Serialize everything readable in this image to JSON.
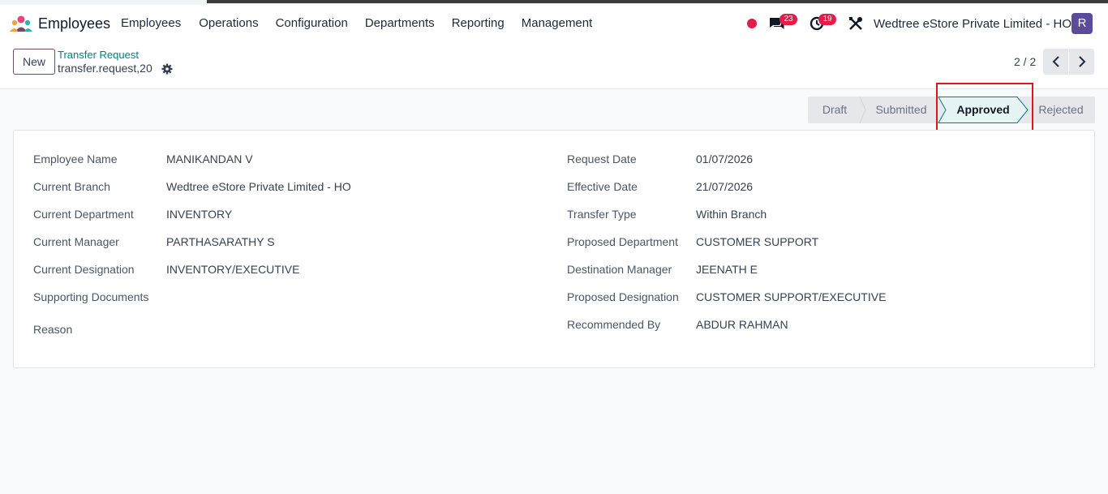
{
  "navbar": {
    "app_name": "Employees",
    "menu": [
      "Employees",
      "Operations",
      "Configuration",
      "Departments",
      "Reporting",
      "Management"
    ],
    "messages_count": "23",
    "activities_count": "19",
    "company": "Wedtree eStore Private Limited - HO",
    "avatar_initial": "R",
    "colors": {
      "badge": "#e11d48",
      "avatar": "#5b4b9a"
    },
    "icons": [
      "app-logo-icon",
      "status-dot-icon",
      "chat-icon",
      "clock-icon",
      "tools-icon"
    ]
  },
  "control": {
    "new_label": "New",
    "breadcrumb_parent": "Transfer Request",
    "breadcrumb_current": "transfer.request,20",
    "pager": "2 / 2",
    "icons": [
      "gear-icon",
      "chevron-left-icon",
      "chevron-right-icon"
    ]
  },
  "statusbar": {
    "stages": [
      "Draft",
      "Submitted",
      "Approved",
      "Rejected"
    ],
    "active": "Approved",
    "colors": {
      "active_bg": "#e6f4f4",
      "active_border": "#017e84",
      "highlight": "#e3131b"
    }
  },
  "form": {
    "left": [
      {
        "label": "Employee Name",
        "value": "MANIKANDAN V"
      },
      {
        "label": "Current Branch",
        "value": "Wedtree eStore Private Limited - HO"
      },
      {
        "label": "Current Department",
        "value": "INVENTORY"
      },
      {
        "label": "Current Manager",
        "value": "PARTHASARATHY S"
      },
      {
        "label": "Current Designation",
        "value": "INVENTORY/EXECUTIVE"
      },
      {
        "label": "Supporting Documents",
        "value": ""
      },
      {
        "label": "Reason",
        "value": ""
      }
    ],
    "right": [
      {
        "label": "Request Date",
        "value": "01/07/2026"
      },
      {
        "label": "Effective Date",
        "value": "21/07/2026"
      },
      {
        "label": "Transfer Type",
        "value": "Within Branch"
      },
      {
        "label": "Proposed Department",
        "value": "CUSTOMER SUPPORT"
      },
      {
        "label": "Destination Manager",
        "value": "JEENATH E"
      },
      {
        "label": "Proposed Designation",
        "value": "CUSTOMER SUPPORT/EXECUTIVE"
      },
      {
        "label": "Recommended By",
        "value": "ABDUR RAHMAN"
      }
    ]
  }
}
